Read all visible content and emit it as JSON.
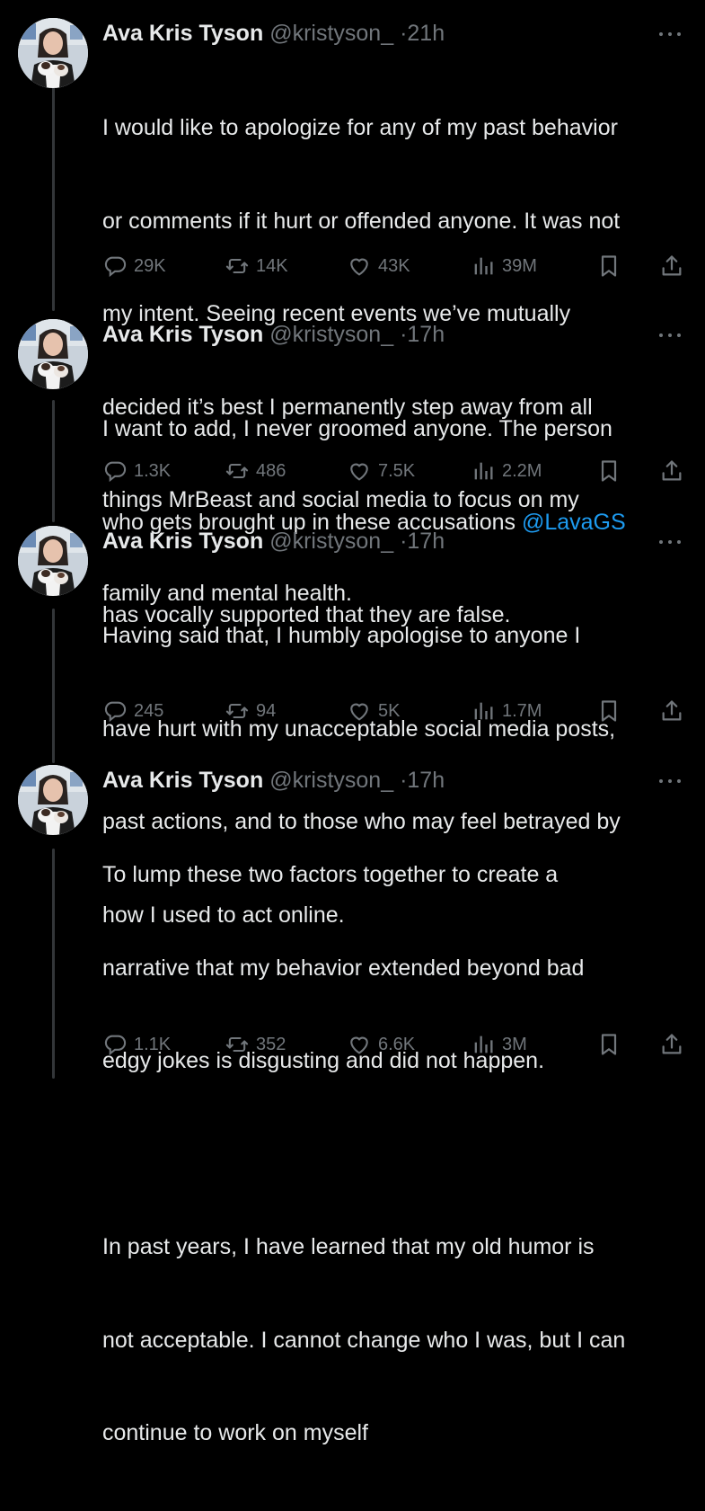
{
  "tweets": [
    {
      "author": "Ava Kris Tyson",
      "handle": "@kristyson_",
      "time": "21h",
      "lines": [
        "I would like to apologize for any of my past behavior",
        "or comments if it hurt or offended anyone. It was not",
        "my intent. Seeing recent events we’ve mutually",
        "decided it’s best I permanently step away from all",
        "things MrBeast and social media to focus on my",
        "family and mental health."
      ],
      "replies": "29K",
      "reposts": "14K",
      "likes": "43K",
      "views": "39M"
    },
    {
      "author": "Ava Kris Tyson",
      "handle": "@kristyson_",
      "time": "17h",
      "line1": "I want to add, I never groomed anyone. The person",
      "line2_before": "who gets brought up in these accusations ",
      "mention": "@LavaGS",
      "line3": "has vocally supported that they are false.",
      "replies": "1.3K",
      "reposts": "486",
      "likes": "7.5K",
      "views": "2.2M"
    },
    {
      "author": "Ava Kris Tyson",
      "handle": "@kristyson_",
      "time": "17h",
      "lines": [
        "Having said that, I humbly apologise to anyone I",
        "have hurt with my unacceptable social media posts,",
        "past actions, and to those who may feel betrayed by",
        "how I used to act online."
      ],
      "replies": "245",
      "reposts": "94",
      "likes": "5K",
      "views": "1.7M"
    },
    {
      "author": "Ava Kris Tyson",
      "handle": "@kristyson_",
      "time": "17h",
      "lines": [
        "To lump these two factors together to create a",
        "narrative that my behavior extended beyond bad",
        "edgy jokes is disgusting and did not happen.",
        "",
        "In past years, I have learned that my old humor is",
        "not acceptable. I cannot change who I was, but I can",
        "continue to work on myself"
      ],
      "replies": "1.1K",
      "reposts": "352",
      "likes": "6.6K",
      "views": "3M"
    }
  ],
  "icons": {
    "reply": "reply-icon",
    "repost": "repost-icon",
    "like": "heart-icon",
    "views": "views-icon",
    "bookmark": "bookmark-icon",
    "share": "share-icon",
    "more": "more-icon"
  },
  "colors": {
    "background": "#000000",
    "text": "#e7e9ea",
    "muted": "#71767b",
    "link": "#1d9bf0",
    "thread_line": "#333639"
  },
  "separator": "·"
}
